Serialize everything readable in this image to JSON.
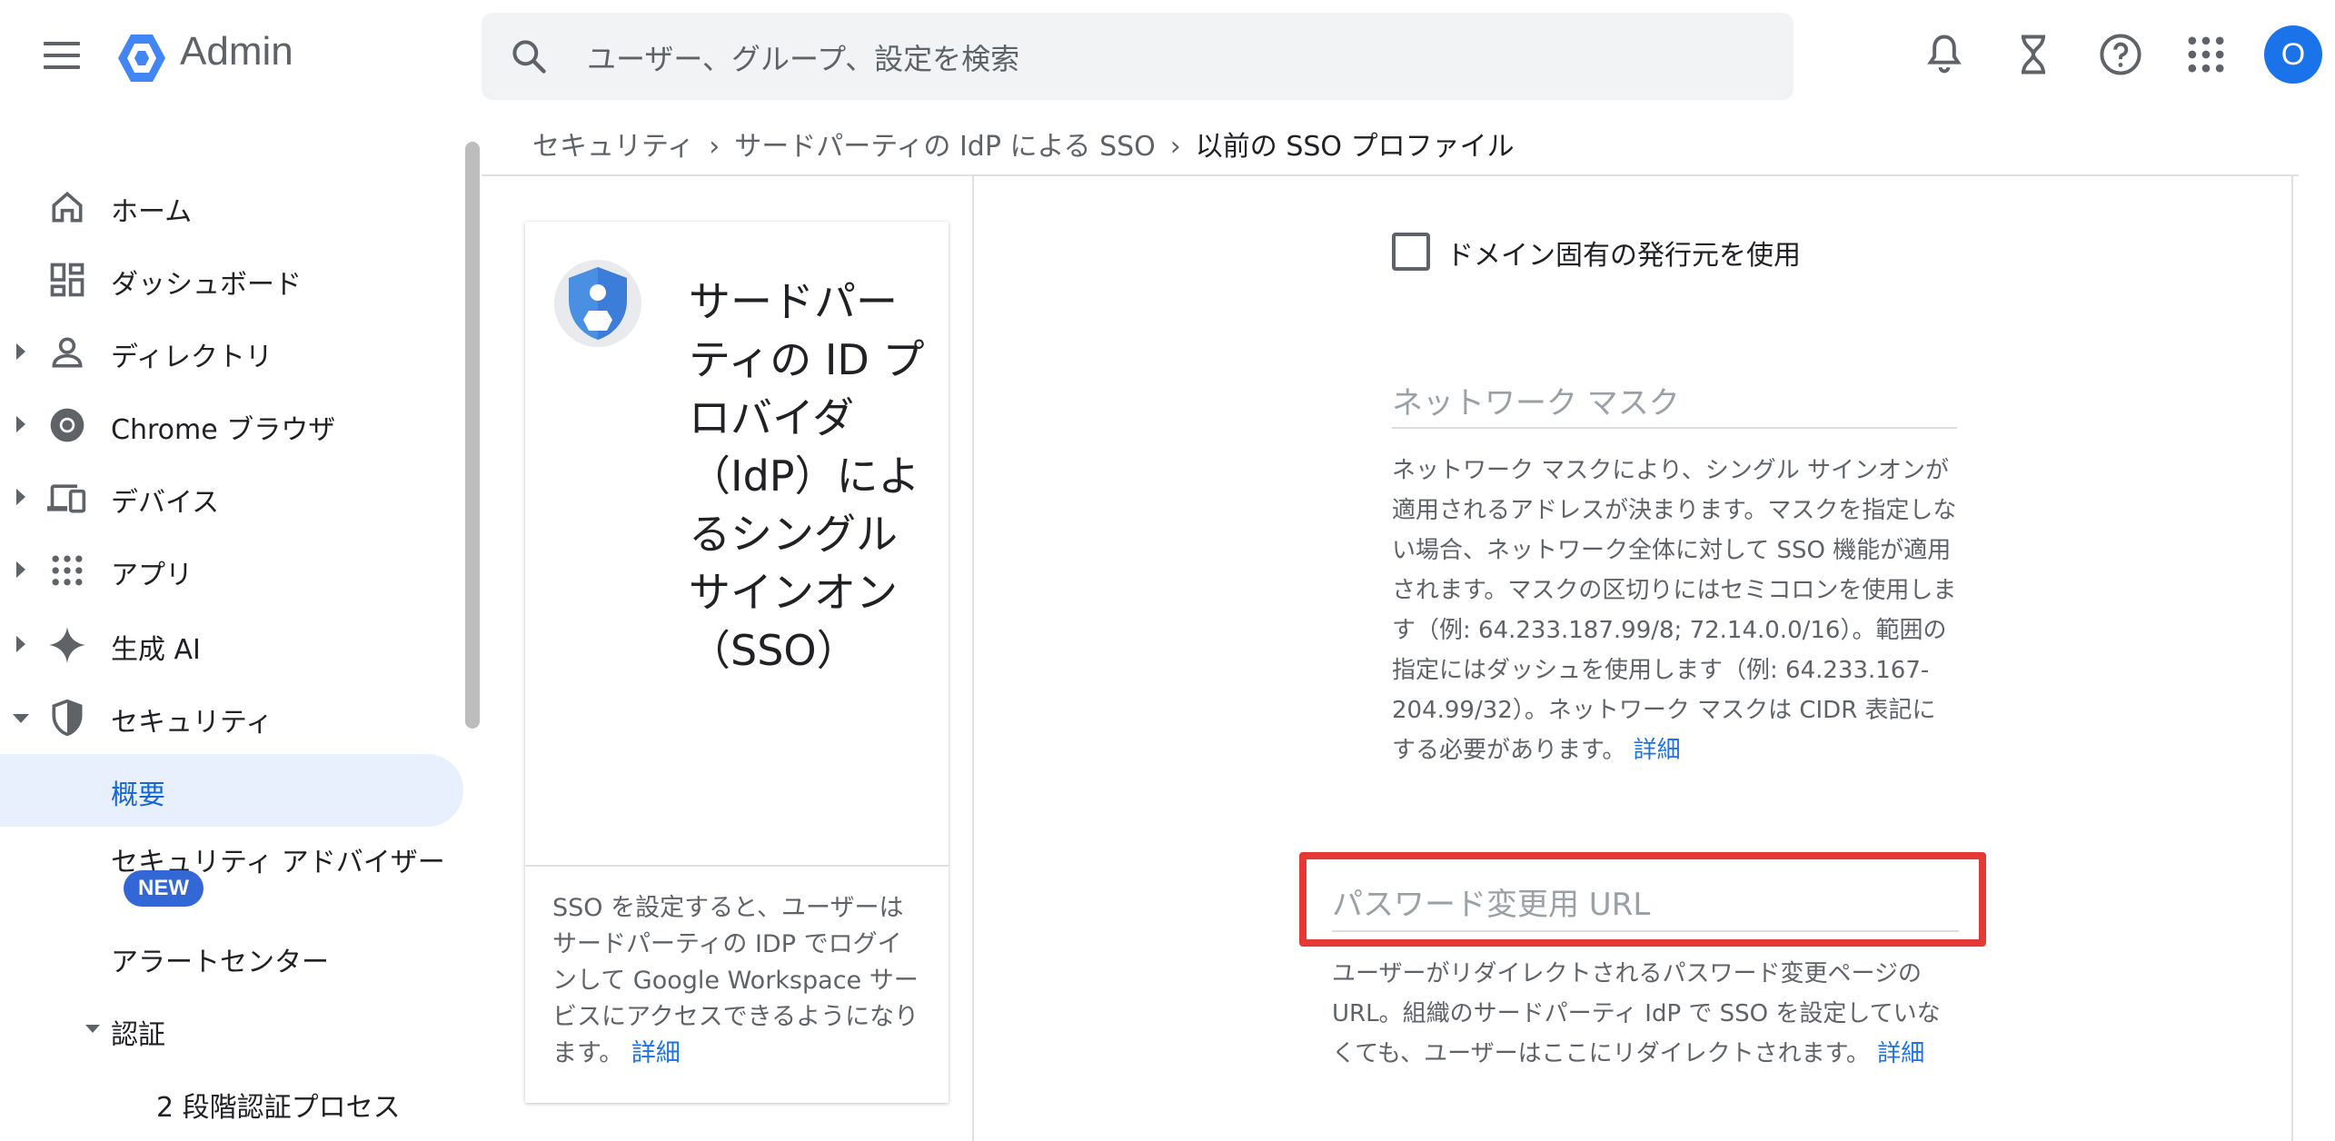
{
  "header": {
    "app_name": "Admin",
    "search_placeholder": "ユーザー、グループ、設定を検索",
    "avatar_initial": "O"
  },
  "sidebar": {
    "items": [
      {
        "label": "ホーム",
        "icon": "home-icon"
      },
      {
        "label": "ダッシュボード",
        "icon": "dashboard-icon"
      },
      {
        "label": "ディレクトリ",
        "icon": "person-icon"
      },
      {
        "label": "Chrome ブラウザ",
        "icon": "chrome-icon"
      },
      {
        "label": "デバイス",
        "icon": "devices-icon"
      },
      {
        "label": "アプリ",
        "icon": "apps-grid-icon"
      },
      {
        "label": "生成 AI",
        "icon": "sparkle-icon"
      },
      {
        "label": "セキュリティ",
        "icon": "shield-icon"
      }
    ],
    "security_sub": {
      "overview": "概要",
      "advisor": "セキュリティ アドバイザー",
      "new_badge": "NEW",
      "alert_center": "アラートセンター",
      "auth": "認証",
      "two_step": "2 段階認証プロセス"
    }
  },
  "breadcrumb": {
    "items": [
      "セキュリティ",
      "サードパーティの IdP による SSO"
    ],
    "current": "以前の SSO プロファイル",
    "separator": "›"
  },
  "card": {
    "title": "サードパーティの ID プロバイダ（IdP）によるシングル サインオン（SSO）",
    "description": "SSO を設定すると、ユーザーはサードパーティの IDP でログインして Google Workspace サービスにアクセスできるようになります。",
    "link": "詳細"
  },
  "form": {
    "domain_issuer_label": "ドメイン固有の発行元を使用",
    "domain_issuer_checked": false,
    "network_mask": {
      "label": "ネットワーク マスク",
      "help": "ネットワーク マスクにより、シングル サインオンが適用されるアドレスが決まります。マスクを指定しない場合、ネットワーク全体に対して SSO 機能が適用されます。マスクの区切りにはセミコロンを使用します（例: 64.233.187.99/8; 72.14.0.0/16）。範囲の指定にはダッシュを使用します（例: 64.233.167-204.99/32）。ネットワーク マスクは CIDR 表記にする必要があります。",
      "link": "詳細"
    },
    "password_url": {
      "label": "パスワード変更用 URL",
      "help": "ユーザーがリダイレクトされるパスワード変更ページの URL。組織のサードパーティ IdP で SSO を設定していなくても、ユーザーはここにリダイレクトされます。",
      "link": "詳細"
    }
  },
  "colors": {
    "accent": "#1a73e8",
    "highlight": "#e53935",
    "active_nav": "#e8f0fe"
  }
}
